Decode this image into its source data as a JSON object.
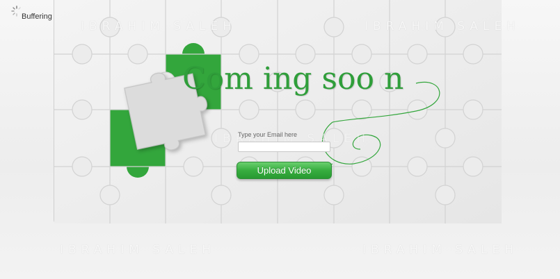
{
  "logo": {
    "text": "Buffering",
    "icon": "spinner-icon"
  },
  "watermark": {
    "text": "IBRAHIM SALEH"
  },
  "heading": {
    "text": "Com ing soo n"
  },
  "email": {
    "label": "Type your Email here",
    "value": "",
    "placeholder": ""
  },
  "upload_button": {
    "label": "Upload Video"
  },
  "colors": {
    "accent": "#33a63c",
    "piece": "#eeeeee",
    "piece_edge": "#cfcfcf",
    "background": "#f4f4f4"
  }
}
